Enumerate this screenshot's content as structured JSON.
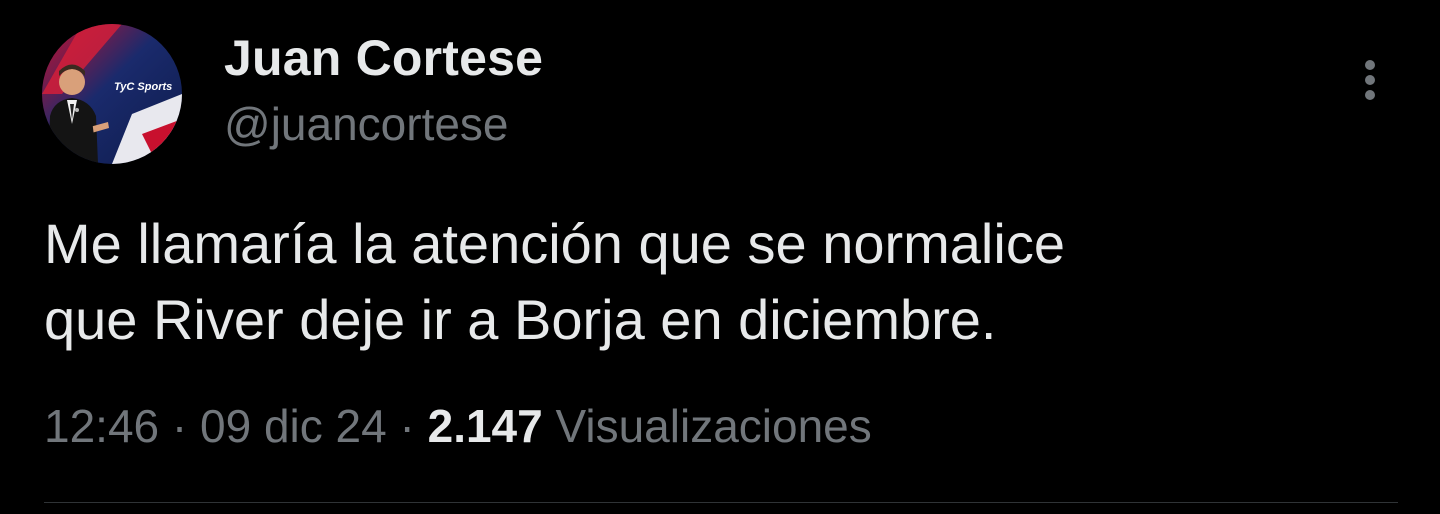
{
  "author": {
    "display_name": "Juan Cortese",
    "handle": "@juancortese",
    "avatar_badge_text": "TyC Sports"
  },
  "tweet": {
    "text": "Me llamaría la atención que se normalice\nque River deje ir a Borja en diciembre.",
    "time": "12:46",
    "date": "09 dic 24",
    "separator": "·",
    "views_count": "2.147",
    "views_label": "Visualizaciones"
  },
  "icons": {
    "more": "more-vertical-icon"
  },
  "colors": {
    "background": "#000000",
    "primary_text": "#e7e9ea",
    "secondary_text": "#71767b",
    "divider": "#2f3336"
  }
}
